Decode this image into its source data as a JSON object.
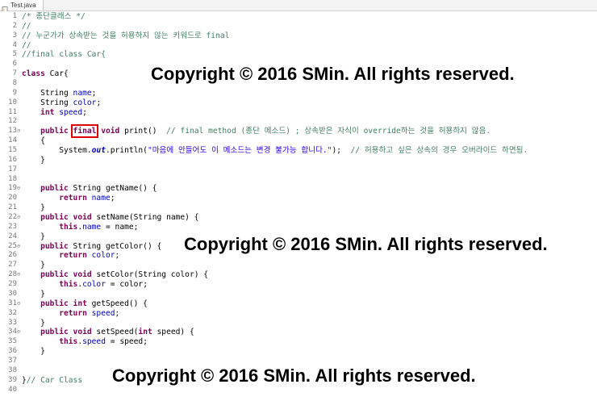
{
  "tab": {
    "title": "Test.java",
    "icon": "java-file-icon"
  },
  "editor": {
    "fold_marker": "⊖",
    "lines": [
      {
        "n": "1",
        "fold": false,
        "segs": [
          {
            "t": "/* 종단클래스 */",
            "c": "cm"
          }
        ]
      },
      {
        "n": "2",
        "fold": false,
        "segs": [
          {
            "t": "//",
            "c": "cm"
          }
        ]
      },
      {
        "n": "3",
        "fold": false,
        "segs": [
          {
            "t": "// 누군가가 상속받는 것을 허용하지 않는 키워드로 final",
            "c": "cm"
          }
        ]
      },
      {
        "n": "4",
        "fold": false,
        "segs": [
          {
            "t": "//",
            "c": "cm"
          }
        ]
      },
      {
        "n": "5",
        "fold": false,
        "segs": [
          {
            "t": "//final class Car{",
            "c": "cm"
          }
        ]
      },
      {
        "n": "6",
        "fold": false,
        "segs": []
      },
      {
        "n": "7",
        "fold": false,
        "segs": [
          {
            "t": "class",
            "c": "kw"
          },
          {
            "t": " Car{",
            "c": ""
          }
        ]
      },
      {
        "n": "8",
        "fold": false,
        "segs": []
      },
      {
        "n": "9",
        "fold": false,
        "segs": [
          {
            "t": "    String ",
            "c": ""
          },
          {
            "t": "name",
            "c": "fld"
          },
          {
            "t": ";",
            "c": ""
          }
        ]
      },
      {
        "n": "10",
        "fold": false,
        "segs": [
          {
            "t": "    String ",
            "c": ""
          },
          {
            "t": "color",
            "c": "fld"
          },
          {
            "t": ";",
            "c": ""
          }
        ]
      },
      {
        "n": "11",
        "fold": false,
        "segs": [
          {
            "t": "    ",
            "c": ""
          },
          {
            "t": "int",
            "c": "kw"
          },
          {
            "t": " ",
            "c": ""
          },
          {
            "t": "speed",
            "c": "fld"
          },
          {
            "t": ";",
            "c": ""
          }
        ]
      },
      {
        "n": "12",
        "fold": false,
        "segs": []
      },
      {
        "n": "13",
        "fold": true,
        "segs": [
          {
            "t": "    ",
            "c": ""
          },
          {
            "t": "public",
            "c": "kw"
          },
          {
            "t": " ",
            "c": ""
          },
          {
            "t": "final",
            "c": "kw hl"
          },
          {
            "t": " ",
            "c": ""
          },
          {
            "t": "void",
            "c": "kw"
          },
          {
            "t": " print()  ",
            "c": ""
          },
          {
            "t": "// final method (종단 메소드) ; 상속받은 자식이 override하는 것을 허용하지 않음.",
            "c": "cm"
          }
        ]
      },
      {
        "n": "14",
        "fold": false,
        "segs": [
          {
            "t": "    {",
            "c": ""
          }
        ]
      },
      {
        "n": "15",
        "fold": false,
        "segs": [
          {
            "t": "        System.",
            "c": ""
          },
          {
            "t": "out",
            "c": "sf"
          },
          {
            "t": ".println(",
            "c": ""
          },
          {
            "t": "\"마음에 안들어도 이 메소드는 변경 불가능 합니다.\"",
            "c": "st"
          },
          {
            "t": ");  ",
            "c": ""
          },
          {
            "t": "// 허용하고 싶은 상속의 경우 오버라이드 하면됨.",
            "c": "cm"
          }
        ]
      },
      {
        "n": "16",
        "fold": false,
        "segs": [
          {
            "t": "    }",
            "c": ""
          }
        ]
      },
      {
        "n": "17",
        "fold": false,
        "segs": []
      },
      {
        "n": "18",
        "fold": false,
        "segs": []
      },
      {
        "n": "19",
        "fold": true,
        "segs": [
          {
            "t": "    ",
            "c": ""
          },
          {
            "t": "public",
            "c": "kw"
          },
          {
            "t": " String getName() {",
            "c": ""
          }
        ]
      },
      {
        "n": "20",
        "fold": false,
        "segs": [
          {
            "t": "        ",
            "c": ""
          },
          {
            "t": "return",
            "c": "kw"
          },
          {
            "t": " ",
            "c": ""
          },
          {
            "t": "name",
            "c": "fld"
          },
          {
            "t": ";",
            "c": ""
          }
        ]
      },
      {
        "n": "21",
        "fold": false,
        "segs": [
          {
            "t": "    }",
            "c": ""
          }
        ]
      },
      {
        "n": "22",
        "fold": true,
        "segs": [
          {
            "t": "    ",
            "c": ""
          },
          {
            "t": "public",
            "c": "kw"
          },
          {
            "t": " ",
            "c": ""
          },
          {
            "t": "void",
            "c": "kw"
          },
          {
            "t": " setName(String name) {",
            "c": ""
          }
        ]
      },
      {
        "n": "23",
        "fold": false,
        "segs": [
          {
            "t": "        ",
            "c": ""
          },
          {
            "t": "this",
            "c": "kw"
          },
          {
            "t": ".",
            "c": ""
          },
          {
            "t": "name",
            "c": "fld"
          },
          {
            "t": " = name;",
            "c": ""
          }
        ]
      },
      {
        "n": "24",
        "fold": false,
        "segs": [
          {
            "t": "    }",
            "c": ""
          }
        ]
      },
      {
        "n": "25",
        "fold": true,
        "segs": [
          {
            "t": "    ",
            "c": ""
          },
          {
            "t": "public",
            "c": "kw"
          },
          {
            "t": " String getColor() {",
            "c": ""
          }
        ]
      },
      {
        "n": "26",
        "fold": false,
        "segs": [
          {
            "t": "        ",
            "c": ""
          },
          {
            "t": "return",
            "c": "kw"
          },
          {
            "t": " ",
            "c": ""
          },
          {
            "t": "color",
            "c": "fld"
          },
          {
            "t": ";",
            "c": ""
          }
        ]
      },
      {
        "n": "27",
        "fold": false,
        "segs": [
          {
            "t": "    }",
            "c": ""
          }
        ]
      },
      {
        "n": "28",
        "fold": true,
        "segs": [
          {
            "t": "    ",
            "c": ""
          },
          {
            "t": "public",
            "c": "kw"
          },
          {
            "t": " ",
            "c": ""
          },
          {
            "t": "void",
            "c": "kw"
          },
          {
            "t": " setColor(String color) {",
            "c": ""
          }
        ]
      },
      {
        "n": "29",
        "fold": false,
        "segs": [
          {
            "t": "        ",
            "c": ""
          },
          {
            "t": "this",
            "c": "kw"
          },
          {
            "t": ".",
            "c": ""
          },
          {
            "t": "color",
            "c": "fld"
          },
          {
            "t": " = color;",
            "c": ""
          }
        ]
      },
      {
        "n": "30",
        "fold": false,
        "segs": [
          {
            "t": "    }",
            "c": ""
          }
        ]
      },
      {
        "n": "31",
        "fold": true,
        "segs": [
          {
            "t": "    ",
            "c": ""
          },
          {
            "t": "public",
            "c": "kw"
          },
          {
            "t": " ",
            "c": ""
          },
          {
            "t": "int",
            "c": "kw"
          },
          {
            "t": " getSpeed() {",
            "c": ""
          }
        ]
      },
      {
        "n": "32",
        "fold": false,
        "segs": [
          {
            "t": "        ",
            "c": ""
          },
          {
            "t": "return",
            "c": "kw"
          },
          {
            "t": " ",
            "c": ""
          },
          {
            "t": "speed",
            "c": "fld"
          },
          {
            "t": ";",
            "c": ""
          }
        ]
      },
      {
        "n": "33",
        "fold": false,
        "segs": [
          {
            "t": "    }",
            "c": ""
          }
        ]
      },
      {
        "n": "34",
        "fold": true,
        "segs": [
          {
            "t": "    ",
            "c": ""
          },
          {
            "t": "public",
            "c": "kw"
          },
          {
            "t": " ",
            "c": ""
          },
          {
            "t": "void",
            "c": "kw"
          },
          {
            "t": " setSpeed(",
            "c": ""
          },
          {
            "t": "int",
            "c": "kw"
          },
          {
            "t": " speed) {",
            "c": ""
          }
        ]
      },
      {
        "n": "35",
        "fold": false,
        "segs": [
          {
            "t": "        ",
            "c": ""
          },
          {
            "t": "this",
            "c": "kw"
          },
          {
            "t": ".",
            "c": ""
          },
          {
            "t": "speed",
            "c": "fld"
          },
          {
            "t": " = speed;",
            "c": ""
          }
        ]
      },
      {
        "n": "36",
        "fold": false,
        "segs": [
          {
            "t": "    }",
            "c": ""
          }
        ]
      },
      {
        "n": "37",
        "fold": false,
        "segs": []
      },
      {
        "n": "38",
        "fold": false,
        "segs": []
      },
      {
        "n": "39",
        "fold": false,
        "segs": [
          {
            "t": "}",
            "c": ""
          },
          {
            "t": "// Car Class",
            "c": "cm"
          }
        ]
      },
      {
        "n": "40",
        "fold": false,
        "segs": []
      }
    ]
  },
  "watermarks": [
    "Copyright © 2016 SMin. All rights reserved.",
    "Copyright © 2016 SMin. All rights reserved.",
    "Copyright © 2016 SMin. All rights reserved."
  ],
  "colors": {
    "keyword": "#7f0055",
    "comment": "#3f7f5f",
    "field": "#0000c0",
    "string": "#2a00ff",
    "highlight_box": "#e00000"
  }
}
